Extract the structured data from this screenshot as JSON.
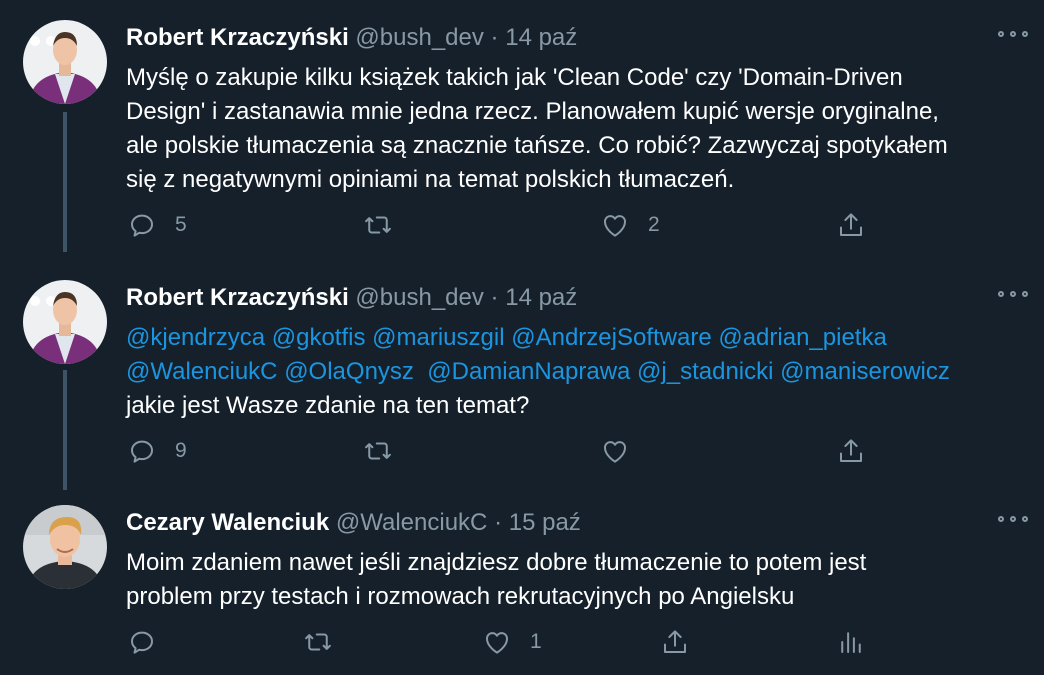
{
  "colors": {
    "background": "#15202b",
    "text": "#ffffff",
    "muted": "#8899a6",
    "link": "#1b95e0",
    "thread_line": "#3d5466"
  },
  "tweets": [
    {
      "name": "Robert Krzaczyński",
      "handle": "@bush_dev",
      "dot": "·",
      "date": "14 paź",
      "lines": [
        "Myślę o zakupie kilku książek takich jak 'Clean Code' czy 'Domain-Driven",
        "Design' i zastanawia mnie jedna rzecz. Planowałem kupić wersje oryginalne,",
        "ale polskie tłumaczenia są znacznie tańsze. Co robić? Zazwyczaj spotykałem",
        "się z negatywnymi opiniami na temat polskich tłumaczeń."
      ],
      "reply_count": "5",
      "retweet_count": "",
      "like_count": "2"
    },
    {
      "name": "Robert Krzaczyński",
      "handle": "@bush_dev",
      "dot": "·",
      "date": "14 paź",
      "mentions_line1": [
        "@kjendrzyca",
        "@gkotfis",
        "@mariuszgil",
        "@AndrzejSoftware",
        "@adrian_pietka"
      ],
      "mentions_line2": [
        "@WalenciukC",
        "@OlaQnysz",
        "@DamianNaprawa",
        "@j_stadnicki",
        "@maniserowicz"
      ],
      "text": "jakie jest Wasze zdanie na ten temat?",
      "reply_count": "9",
      "retweet_count": "",
      "like_count": ""
    },
    {
      "name": "Cezary Walenciuk",
      "handle": "@WalenciukC",
      "dot": "·",
      "date": "15 paź",
      "lines": [
        "Moim zdaniem nawet jeśli znajdziesz dobre tłumaczenie to potem jest",
        "problem przy testach i rozmowach rekrutacyjnych po Angielsku"
      ],
      "reply_count": "",
      "retweet_count": "",
      "like_count": "1"
    }
  ],
  "icons": {
    "reply": "reply-icon",
    "retweet": "retweet-icon",
    "like": "heart-icon",
    "share": "share-icon",
    "analytics": "analytics-icon",
    "more": "more-icon"
  }
}
